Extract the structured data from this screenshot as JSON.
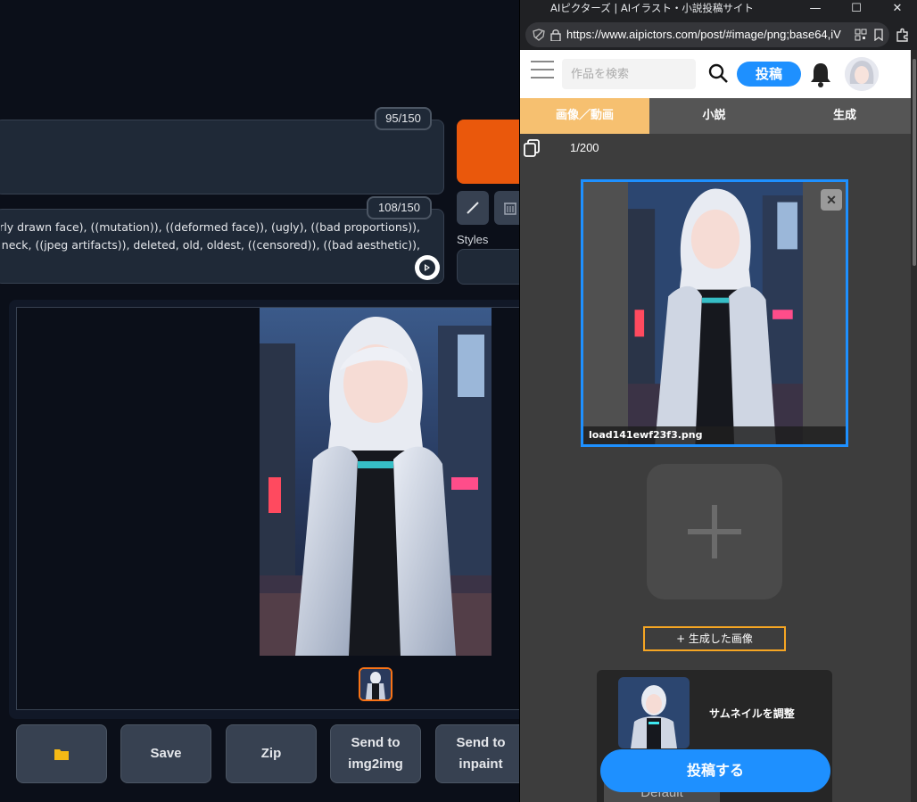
{
  "webui": {
    "prompt_counter": "95/150",
    "negative_counter": "108/150",
    "negative_prompt_lines": [
      "((extra fingers)), (poorly drawn face), ((mutation)), ((deformed face)), (ugly), ((bad proportions)),",
      "(extra limbs), long neck, ((jpeg artifacts)), deleted, old, oldest, ((censored)), ((bad aesthetic)),"
    ],
    "styles_label": "Styles",
    "buttons": {
      "folder": "",
      "save": "Save",
      "zip": "Zip",
      "send_img2img": "Send to img2img",
      "send_inpaint": "Send to inpaint"
    },
    "colors": {
      "accent": "#ea580c",
      "background": "#0b0f19"
    }
  },
  "browser": {
    "window_title": "AIピクターズ | AIイラスト・小説投稿サイト",
    "url": "https://www.aipictors.com/post/#image/png;base64,iV",
    "window_controls": [
      "—",
      "☐",
      "✕"
    ]
  },
  "site": {
    "search_placeholder": "作品を検索",
    "post_button": "投稿",
    "tabs": [
      "画像／動画",
      "小説",
      "生成"
    ],
    "active_tab": 0,
    "image_count": "1/200",
    "uploaded_filename": "load141ewf23f3.png",
    "remove_symbol": "✕",
    "add_generated_button": "+ 生成した画像",
    "thumbnail_label": "サムネイルを調整",
    "default_button": "Default",
    "submit_button": "投稿する",
    "colors": {
      "primary": "#1e90ff",
      "tab_active": "#f6c070",
      "highlight": "#f6a623"
    }
  }
}
